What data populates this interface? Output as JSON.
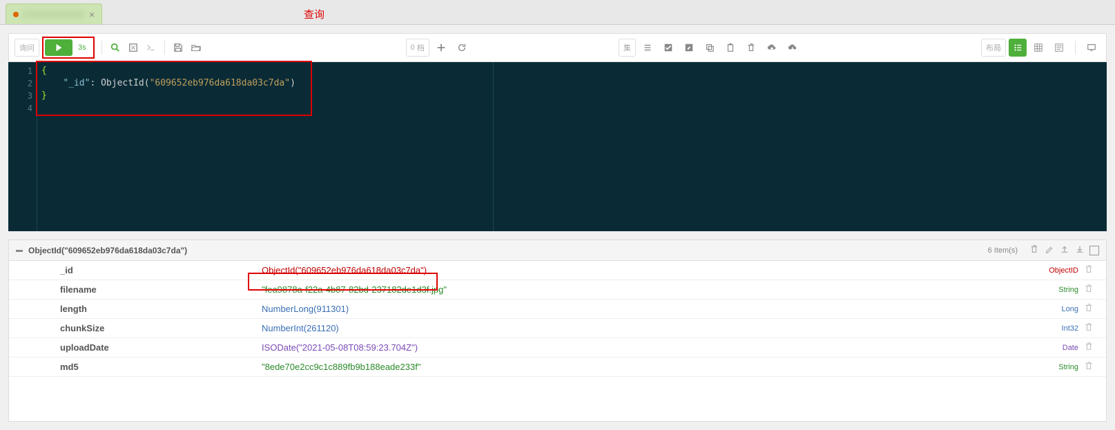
{
  "header": {
    "query_label": "查询"
  },
  "toolbar": {
    "left_label": "询问",
    "run_time": "3s",
    "doc_count": "0",
    "doc_unit": "档",
    "set_label": "集",
    "layout_label": "布局"
  },
  "editor": {
    "lines": [
      "1",
      "2",
      "3",
      "4"
    ],
    "code": {
      "open": "{",
      "key": "\"_id\"",
      "colon": ": ",
      "func": "ObjectId(",
      "str": "\"609652eb976da618da03c7da\"",
      "funcEnd": ")",
      "close": "}"
    }
  },
  "result": {
    "header": "ObjectId(\"609652eb976da618da03c7da\")",
    "count": "6 Item(s)",
    "rows": [
      {
        "key": "_id",
        "value": "ObjectId(\"609652eb976da618da03c7da\")",
        "type": "ObjectID",
        "vcolor": "#c00000",
        "tcolor": "#c00000"
      },
      {
        "key": "filename",
        "value": "\"fea9878a-f22a-4b87-82bd-237182de1d3f.jpg\"",
        "type": "String",
        "vcolor": "#2a8a2a",
        "tcolor": "#2a8a2a"
      },
      {
        "key": "length",
        "value": "NumberLong(911301)",
        "type": "Long",
        "vcolor": "#3a6fb5",
        "tcolor": "#3a6fb5"
      },
      {
        "key": "chunkSize",
        "value": "NumberInt(261120)",
        "type": "Int32",
        "vcolor": "#3a6fb5",
        "tcolor": "#3a6fb5"
      },
      {
        "key": "uploadDate",
        "value": "ISODate(\"2021-05-08T08:59:23.704Z\")",
        "type": "Date",
        "vcolor": "#7a4ab5",
        "tcolor": "#7a4ab5"
      },
      {
        "key": "md5",
        "value": "\"8ede70e2cc9c1c889fb9b188eade233f\"",
        "type": "String",
        "vcolor": "#2a8a2a",
        "tcolor": "#2a8a2a"
      }
    ]
  }
}
